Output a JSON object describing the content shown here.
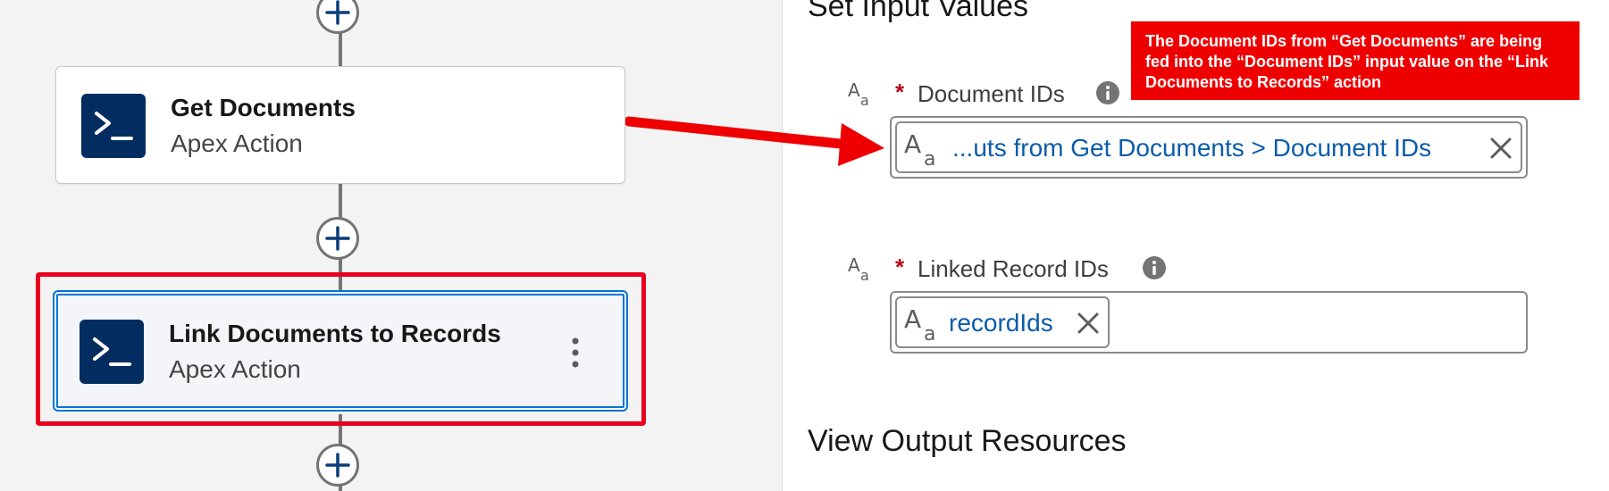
{
  "canvas": {
    "nodes": [
      {
        "title": "Get Documents",
        "subtitle": "Apex Action"
      },
      {
        "title": "Link Documents to Records",
        "subtitle": "Apex Action"
      }
    ]
  },
  "panel": {
    "section_title": "Set Input Values",
    "fields": [
      {
        "required": "*",
        "label": "Document IDs",
        "pill_value": "...uts from Get Documents > Document IDs"
      },
      {
        "required": "*",
        "label": "Linked Record IDs",
        "pill_value": "recordIds"
      }
    ],
    "output_title": "View Output Resources"
  },
  "annotation": {
    "callout_text": "The Document IDs from “Get Documents” are being fed into the “Document IDs” input value on the “Link Documents to Records” action"
  },
  "colors": {
    "node_icon_bg": "#032d60",
    "pill_text": "#0b5cab",
    "annotation_red": "#ee0000",
    "selection_blue": "#0176d3"
  },
  "icons": [
    "add-icon",
    "apex-terminal-icon",
    "text-type-icon",
    "info-icon",
    "close-icon",
    "kebab-menu-icon",
    "annotation-arrow"
  ]
}
